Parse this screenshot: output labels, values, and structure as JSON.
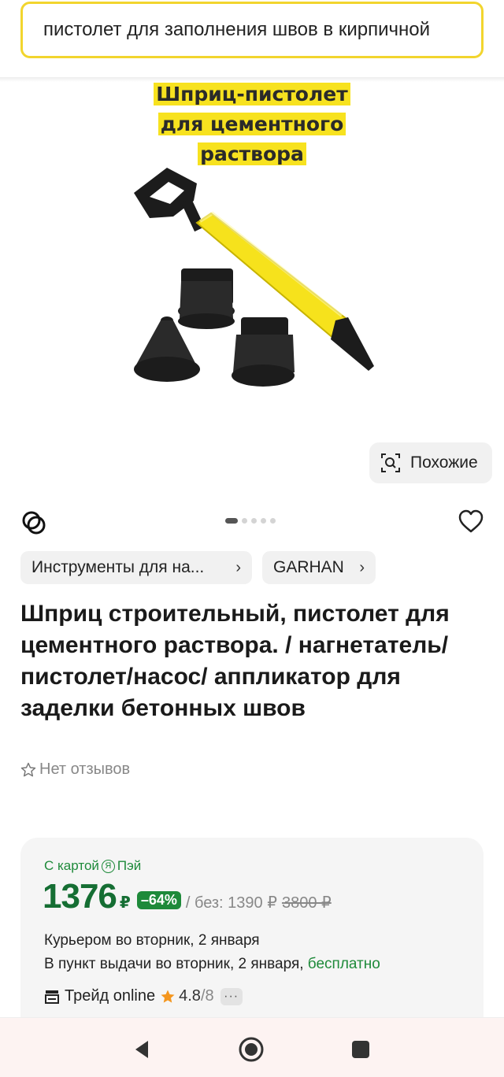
{
  "search": {
    "query": "пистолет для заполнения швов в кирпичной"
  },
  "image": {
    "caption_lines": [
      "Шприц-пистолет",
      "для цементного",
      "раствора"
    ]
  },
  "similar_button": {
    "label": "Похожие",
    "icon": "image-search-icon"
  },
  "carousel": {
    "total": 5,
    "active_index": 0
  },
  "chips": [
    {
      "label": "Инструменты для на..."
    },
    {
      "label": "GARHAN"
    }
  ],
  "product": {
    "title": "Шприц строительный, пистолет для цементного раствора. / нагнетатель/пистолет/насос/ аппликатор для заделки бетонных швов",
    "reviews": "Нет отзывов"
  },
  "offer": {
    "card_label_prefix": "С картой",
    "card_badge": "Я",
    "card_label_suffix": "Пэй",
    "price": "1376",
    "currency": "₽",
    "discount": "–64%",
    "without_card": "/ без: 1390 ₽",
    "old_price": "3800 ₽",
    "delivery_courier": "Курьером во вторник, 2 января",
    "delivery_pickup": "В пункт выдачи во вторник, 2 января,",
    "delivery_pickup_free": "бесплатно",
    "seller": "Трейд online",
    "rating": "4.8",
    "rating_count": "/8",
    "more": "···"
  },
  "colors": {
    "accent_yellow": "#f2d52e",
    "price_green": "#156e33",
    "badge_green": "#1e8a3a",
    "star_orange": "#f4961e"
  }
}
